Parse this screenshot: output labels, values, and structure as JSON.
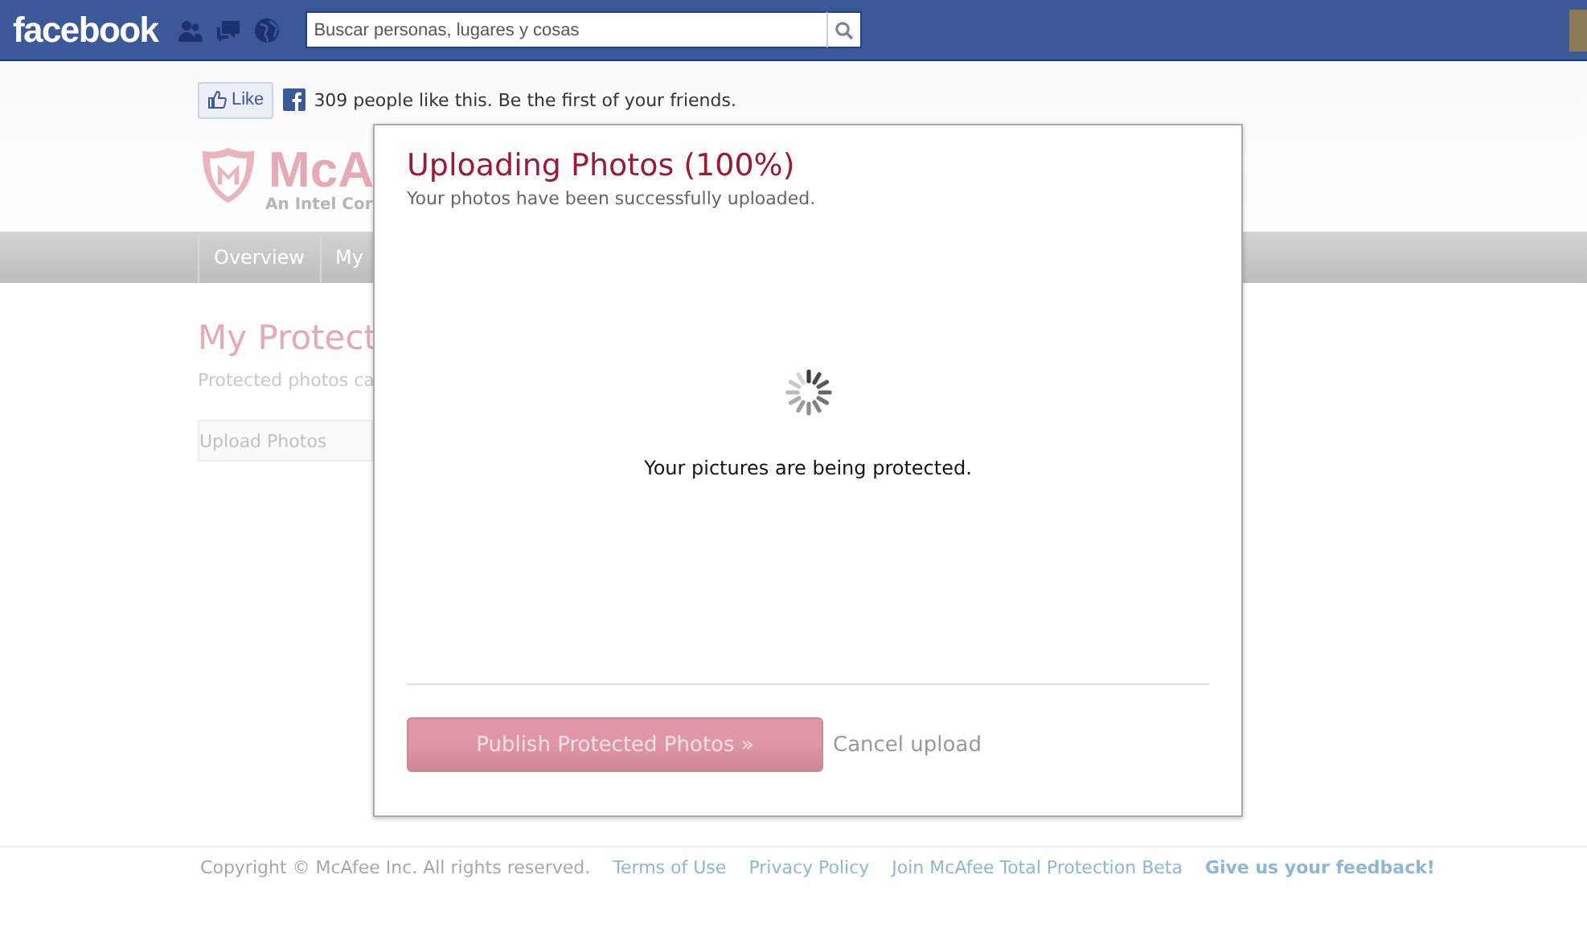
{
  "header": {
    "logo": "facebook",
    "search": {
      "placeholder": "Buscar personas, lugares y cosas"
    }
  },
  "like_bar": {
    "button": "Like",
    "text": "309 people like this. Be the first of your friends."
  },
  "brand": {
    "name": "McA",
    "tagline": "An Intel Cor"
  },
  "nav": {
    "items": [
      {
        "label": "Overview"
      },
      {
        "label": "My"
      }
    ]
  },
  "page": {
    "title": "My Protect",
    "subtitle": "Protected photos ca",
    "button": "Upload Photos"
  },
  "dialog": {
    "title": "Uploading Photos (100%)",
    "subtitle": "Your photos have been successfully uploaded.",
    "status": "Your pictures are being protected.",
    "publish_button": {
      "label": "Publish Protected Photos »",
      "disabled": true
    },
    "cancel": "Cancel upload"
  },
  "footer": {
    "copyright": "Copyright © McAfee Inc. All rights reserved.",
    "links": [
      {
        "label": "Terms of Use",
        "kind": "link"
      },
      {
        "label": "Privacy Policy",
        "kind": "link"
      },
      {
        "label": "Join McAfee Total Protection Beta",
        "kind": "link"
      },
      {
        "label": "Give us your feedback!",
        "kind": "feedback"
      }
    ]
  }
}
